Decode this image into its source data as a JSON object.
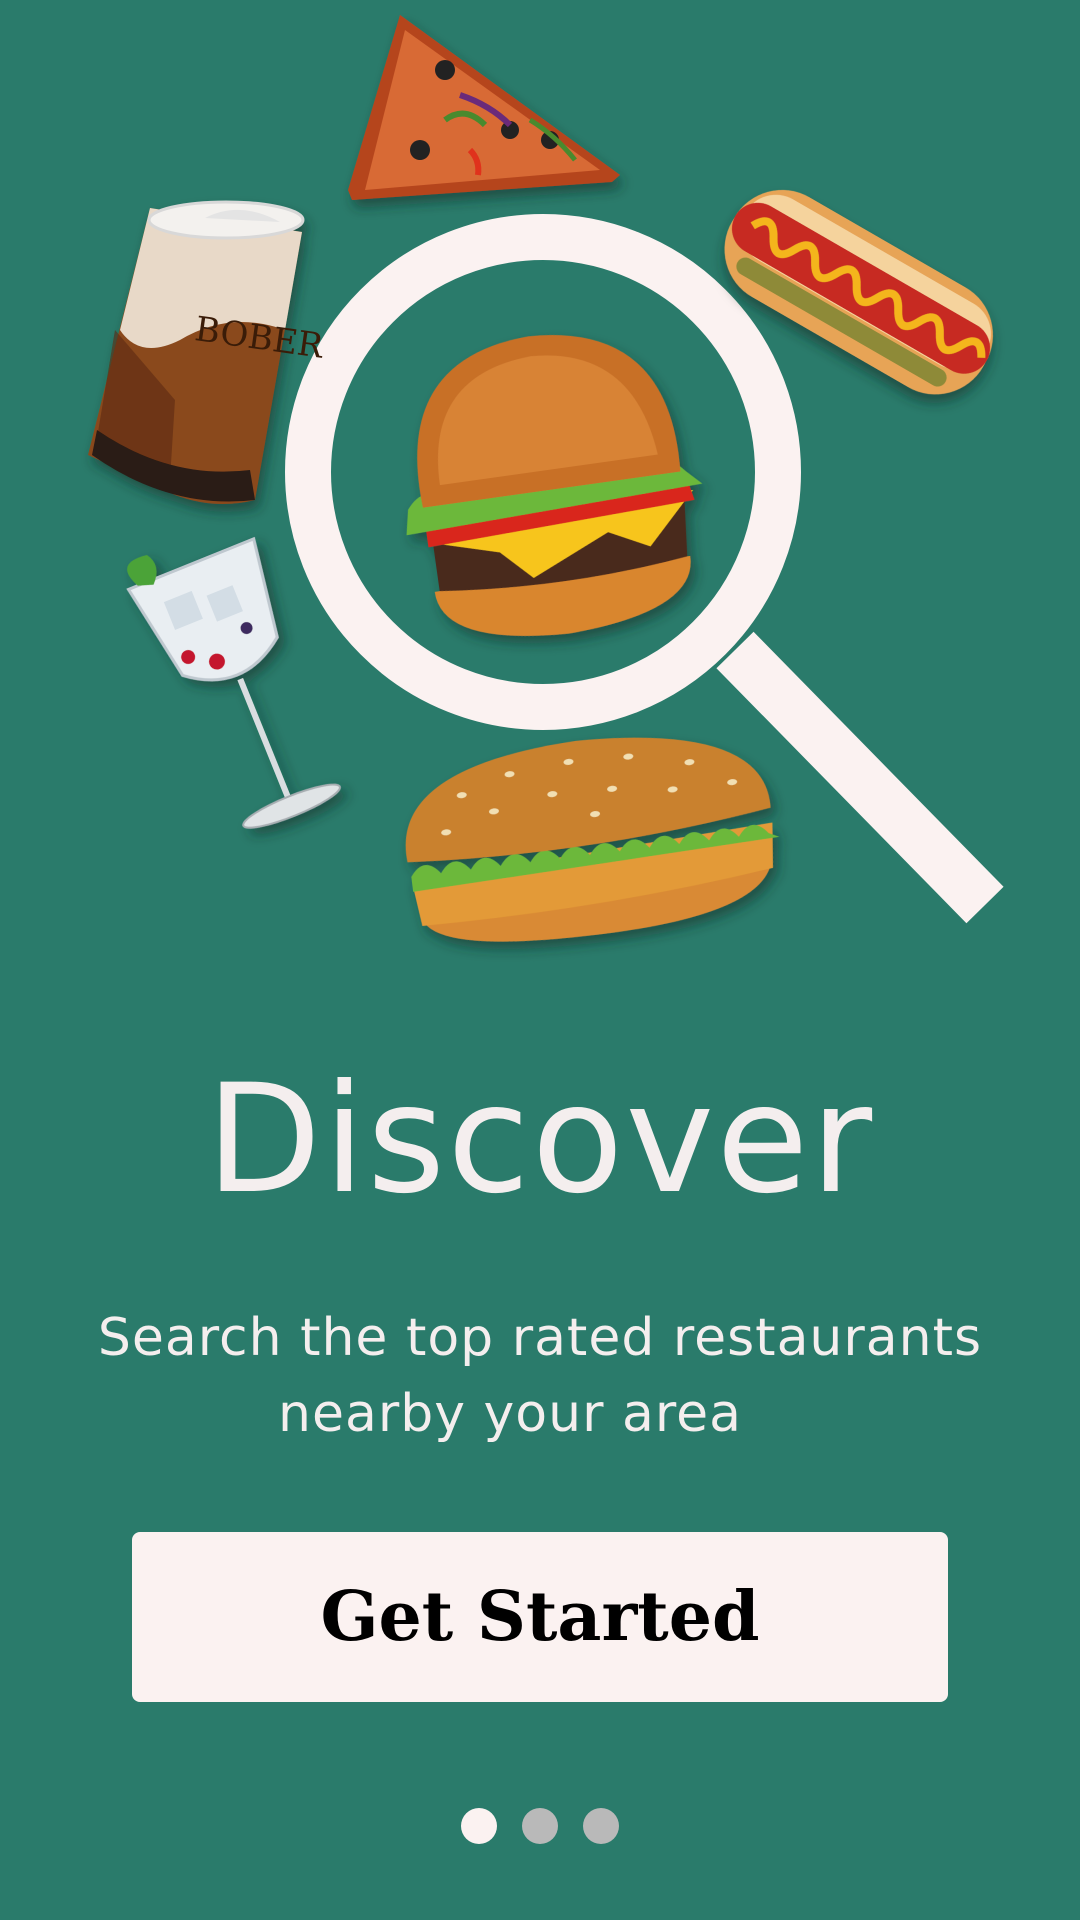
{
  "colors": {
    "background": "#2a7b6b",
    "accent_light": "#fbf2f1",
    "dot_inactive": "#b9b9b9"
  },
  "hero": {
    "icon": "magnifier-icon",
    "items": [
      "pizza-slice",
      "bubble-tea-cup",
      "hot-dog",
      "burger",
      "cocktail-glass",
      "chicken-sub-sandwich"
    ]
  },
  "cup_logo": "BOBER",
  "title": "Discover",
  "subtitle": {
    "line1": "Search the top rated restaurants",
    "line2": "nearby your area"
  },
  "cta": {
    "label": "Get Started"
  },
  "pagination": {
    "total": 3,
    "active": 1
  }
}
